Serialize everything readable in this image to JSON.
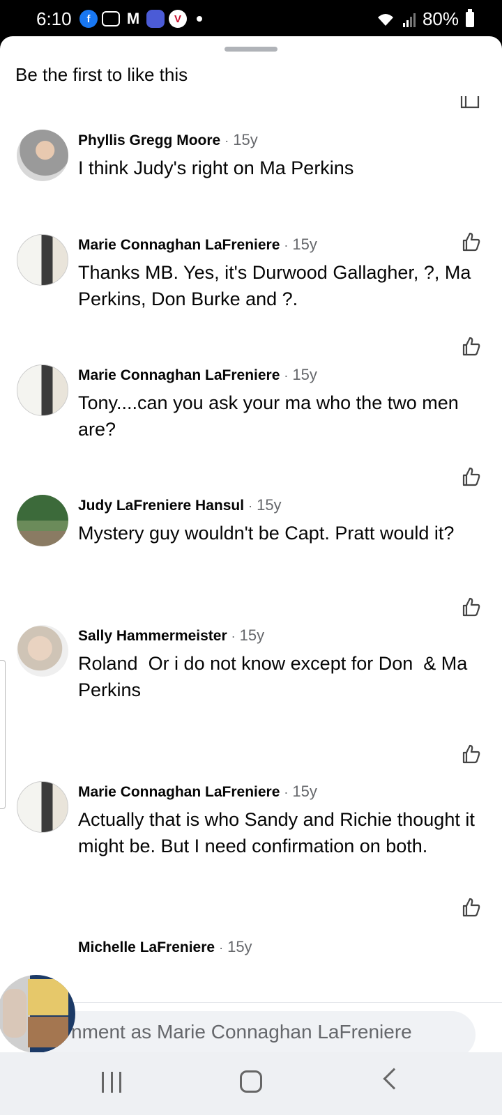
{
  "status": {
    "time": "6:10",
    "battery": "80%",
    "icons": [
      "facebook-icon",
      "camera-icon",
      "gmail-icon",
      "messages-icon",
      "vivaldi-icon",
      "dot-icon",
      "wifi-icon",
      "signal-icon",
      "battery-icon"
    ]
  },
  "sheet": {
    "title": "Be the first to like this"
  },
  "comments": [
    {
      "name": "Phyllis Gregg Moore",
      "time": "15y",
      "text": "I think Judy's right on Ma Perkins"
    },
    {
      "name": "Marie Connaghan LaFreniere",
      "time": "15y",
      "text": "Thanks MB. Yes, it's Durwood Gallagher, ?, Ma Perkins, Don Burke and ?."
    },
    {
      "name": "Marie Connaghan LaFreniere",
      "time": "15y",
      "text": "Tony....can you ask your ma who the two men are?"
    },
    {
      "name": "Judy LaFreniere Hansul",
      "time": "15y",
      "text": "Mystery guy wouldn't be Capt. Pratt would it?"
    },
    {
      "name": "Sally Hammermeister",
      "time": "15y",
      "text": "Roland  Or i do not know except for Don  & Ma Perkins"
    },
    {
      "name": "Marie Connaghan LaFreniere",
      "time": "15y",
      "text": "Actually that is who Sandy and Richie thought it might be. But I need confirmation on both."
    },
    {
      "name": "Michelle LaFreniere",
      "time": "15y",
      "text": ""
    }
  ],
  "separator": "·",
  "composer": {
    "placeholder": "nment as Marie Connaghan LaFreniere"
  },
  "colors": {
    "facebook_blue": "#1877f2",
    "secondary_text": "#65676b",
    "composer_bg": "#f0f2f5"
  }
}
